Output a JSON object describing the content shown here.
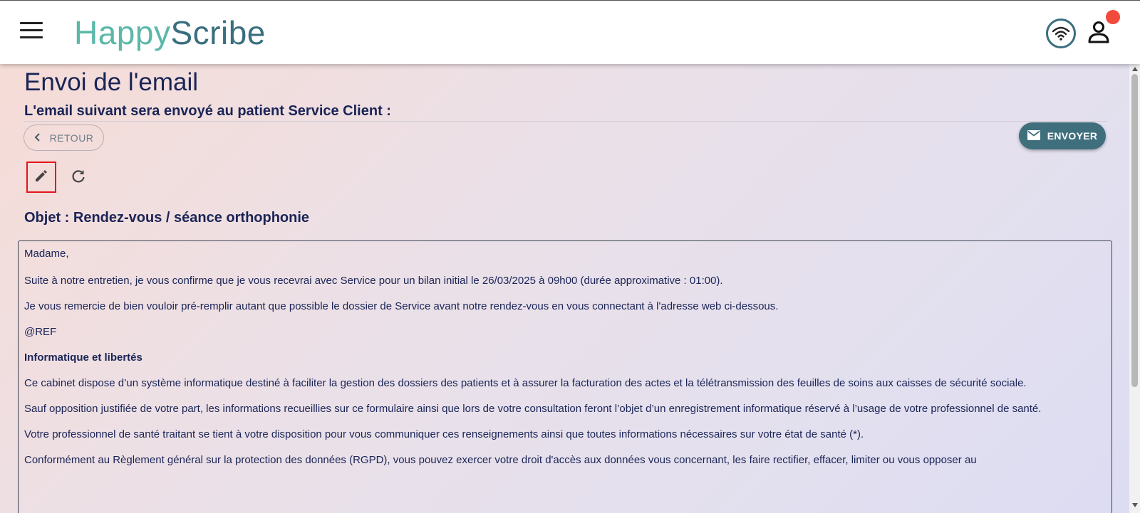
{
  "header": {
    "logo_part1": "Happy",
    "logo_part2": "Scribe",
    "brand_colors": {
      "happy": "#5ab8a8",
      "scribe": "#3a6f7f",
      "notification": "#f24a3d"
    },
    "icons": [
      "menu-icon",
      "wifi-icon",
      "user-icon"
    ]
  },
  "page": {
    "title": "Envoi de l'email",
    "subtitle": "L'email suivant sera envoyé au patient Service Client :",
    "back_label": "RETOUR",
    "send_label": "ENVOYER",
    "send_color": "#3f6f7d",
    "subject": "Objet : Rendez-vous / séance orthophonie"
  },
  "email": {
    "greeting": "Madame,",
    "p1": "Suite à notre entretien, je vous confirme que je vous recevrai avec Service pour un bilan initial le 26/03/2025 à 09h00 (durée approximative : 01:00).",
    "p2": "Je vous remercie de bien vouloir pré-remplir autant que possible le dossier de Service avant notre rendez-vous en vous connectant à l'adresse web ci-dessous.",
    "p3": "@REF",
    "heading": "Informatique et libertés",
    "p4": "Ce cabinet dispose d’un système informatique destiné à faciliter la gestion des dossiers des patients et à assurer la facturation des actes et la télétransmission des feuilles de soins aux caisses de sécurité sociale.",
    "p5": "Sauf opposition justifiée de votre part, les informations recueillies sur ce formulaire ainsi que lors de votre consultation feront l’objet d’un enregistrement informatique réservé à l’usage de votre professionnel de santé.",
    "p6": "Votre professionnel de santé traitant se tient à votre disposition pour vous communiquer ces renseignements ainsi que toutes informations nécessaires sur votre état de santé (*).",
    "p7": "Conformément au Règlement général sur la protection des données (RGPD), vous pouvez exercer votre droit d'accès aux données vous concernant, les faire rectifier, effacer, limiter ou vous opposer au"
  }
}
